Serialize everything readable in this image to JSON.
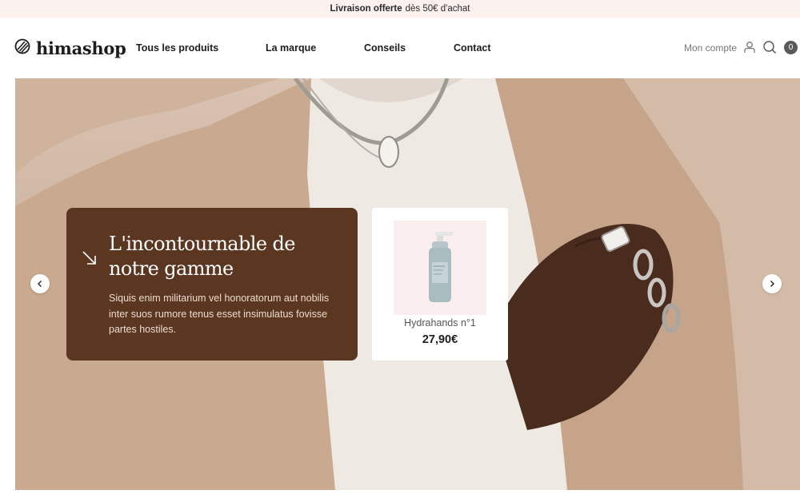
{
  "announcement": {
    "bold": "Livraison offerte",
    "rest": "dès 50€ d'achat"
  },
  "brand": {
    "name": "himashop",
    "icon": "brand-logo-icon"
  },
  "nav": {
    "items": [
      "Tous les produits",
      "La marque",
      "Conseils",
      "Contact"
    ]
  },
  "header_actions": {
    "account_label": "Mon compte",
    "account_icon": "user-icon",
    "search_icon": "search-icon",
    "cart_count": "0"
  },
  "hero": {
    "title": "L'incontournable de notre gamme",
    "text": "Siquis enim militarium vel honoratorum aut nobilis inter suos rumore tenus esset insimulatus fovisse partes hostiles.",
    "promo_icon": "arrow-down-right-icon",
    "prev_icon": "chevron-left-icon",
    "next_icon": "chevron-right-icon",
    "promo_color": "#5b3722"
  },
  "product": {
    "name": "Hydrahands n°1",
    "price": "27,90€",
    "image_bg": "#fbeeee"
  },
  "colors": {
    "announcement_bg": "#fbf1ef",
    "text": "#1d1d1d"
  }
}
